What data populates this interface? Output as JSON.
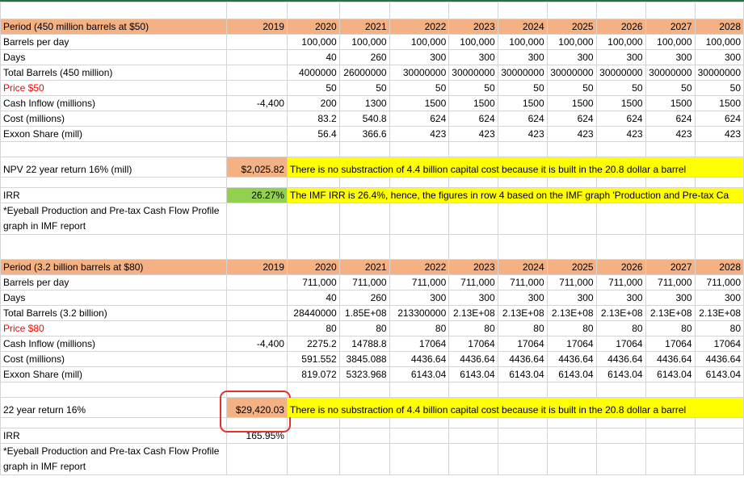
{
  "section1": {
    "header_label": "Period (450 million barrels at $50)",
    "years": [
      "2019",
      "2020",
      "2021",
      "2022",
      "2023",
      "2024",
      "2025",
      "2026",
      "2027",
      "2028"
    ],
    "rows": [
      {
        "label": "Barrels per day",
        "red": false,
        "values": [
          "",
          "100,000",
          "100,000",
          "100,000",
          "100,000",
          "100,000",
          "100,000",
          "100,000",
          "100,000",
          "100,000"
        ]
      },
      {
        "label": "Days",
        "red": false,
        "values": [
          "",
          "40",
          "260",
          "300",
          "300",
          "300",
          "300",
          "300",
          "300",
          "300"
        ]
      },
      {
        "label": "Total Barrels (450 million)",
        "red": false,
        "values": [
          "",
          "4000000",
          "26000000",
          "30000000",
          "30000000",
          "30000000",
          "30000000",
          "30000000",
          "30000000",
          "30000000"
        ]
      },
      {
        "label": "Price $50",
        "red": true,
        "values": [
          "",
          "50",
          "50",
          "50",
          "50",
          "50",
          "50",
          "50",
          "50",
          "50"
        ]
      },
      {
        "label": "Cash Inflow (millions)",
        "red": false,
        "values": [
          "-4,400",
          "200",
          "1300",
          "1500",
          "1500",
          "1500",
          "1500",
          "1500",
          "1500",
          "1500"
        ]
      },
      {
        "label": "Cost (millions)",
        "red": false,
        "values": [
          "",
          "83.2",
          "540.8",
          "624",
          "624",
          "624",
          "624",
          "624",
          "624",
          "624"
        ]
      },
      {
        "label": "Exxon Share (mill)",
        "red": false,
        "values": [
          "",
          "56.4",
          "366.6",
          "423",
          "423",
          "423",
          "423",
          "423",
          "423",
          "423"
        ]
      }
    ],
    "npv_label": "NPV 22 year return 16% (mill)",
    "npv_value": "$2,025.82",
    "npv_note": "There is no substraction of 4.4 billion capital cost because it is built in the 20.8 dollar a barrel",
    "irr_label": "IRR",
    "irr_value": "26.27%",
    "irr_note": "The IMF IRR is 26.4%, hence, the figures in row 4 based on the IMF graph 'Production and Pre-tax Ca",
    "eyeball_note": "*Eyeball Production and Pre-tax Cash Flow Profile graph in IMF report"
  },
  "section2": {
    "header_label": "Period (3.2 billion barrels at $80)",
    "years": [
      "2019",
      "2020",
      "2021",
      "2022",
      "2023",
      "2024",
      "2025",
      "2026",
      "2027",
      "2028"
    ],
    "rows": [
      {
        "label": "Barrels per day",
        "red": false,
        "values": [
          "",
          "711,000",
          "711,000",
          "711,000",
          "711,000",
          "711,000",
          "711,000",
          "711,000",
          "711,000",
          "711,000"
        ]
      },
      {
        "label": "Days",
        "red": false,
        "values": [
          "",
          "40",
          "260",
          "300",
          "300",
          "300",
          "300",
          "300",
          "300",
          "300"
        ]
      },
      {
        "label": "Total Barrels (3.2 billion)",
        "red": false,
        "values": [
          "",
          "28440000",
          "1.85E+08",
          "213300000",
          "2.13E+08",
          "2.13E+08",
          "2.13E+08",
          "2.13E+08",
          "2.13E+08",
          "2.13E+08"
        ]
      },
      {
        "label": "Price $80",
        "red": true,
        "values": [
          "",
          "80",
          "80",
          "80",
          "80",
          "80",
          "80",
          "80",
          "80",
          "80"
        ]
      },
      {
        "label": "Cash Inflow (millions)",
        "red": false,
        "values": [
          "-4,400",
          "2275.2",
          "14788.8",
          "17064",
          "17064",
          "17064",
          "17064",
          "17064",
          "17064",
          "17064"
        ]
      },
      {
        "label": "Cost (millions)",
        "red": false,
        "values": [
          "",
          "591.552",
          "3845.088",
          "4436.64",
          "4436.64",
          "4436.64",
          "4436.64",
          "4436.64",
          "4436.64",
          "4436.64"
        ]
      },
      {
        "label": "Exxon Share (mill)",
        "red": false,
        "values": [
          "",
          "819.072",
          "5323.968",
          "6143.04",
          "6143.04",
          "6143.04",
          "6143.04",
          "6143.04",
          "6143.04",
          "6143.04"
        ]
      }
    ],
    "npv_label": "22 year return 16%",
    "npv_value": "$29,420.03",
    "npv_note": "There is no substraction of 4.4 billion capital cost because it is built in the 20.8 dollar a barrel",
    "irr_label": "IRR",
    "irr_value": "165.95%",
    "eyeball_note": "*Eyeball Production and Pre-tax Cash Flow Profile graph in IMF report"
  },
  "colors": {
    "header_bg": "#f4b183",
    "note_bg": "#ffff00",
    "irr_bg": "#92d050",
    "red_text": "#ff0000",
    "circle": "#e03030"
  }
}
